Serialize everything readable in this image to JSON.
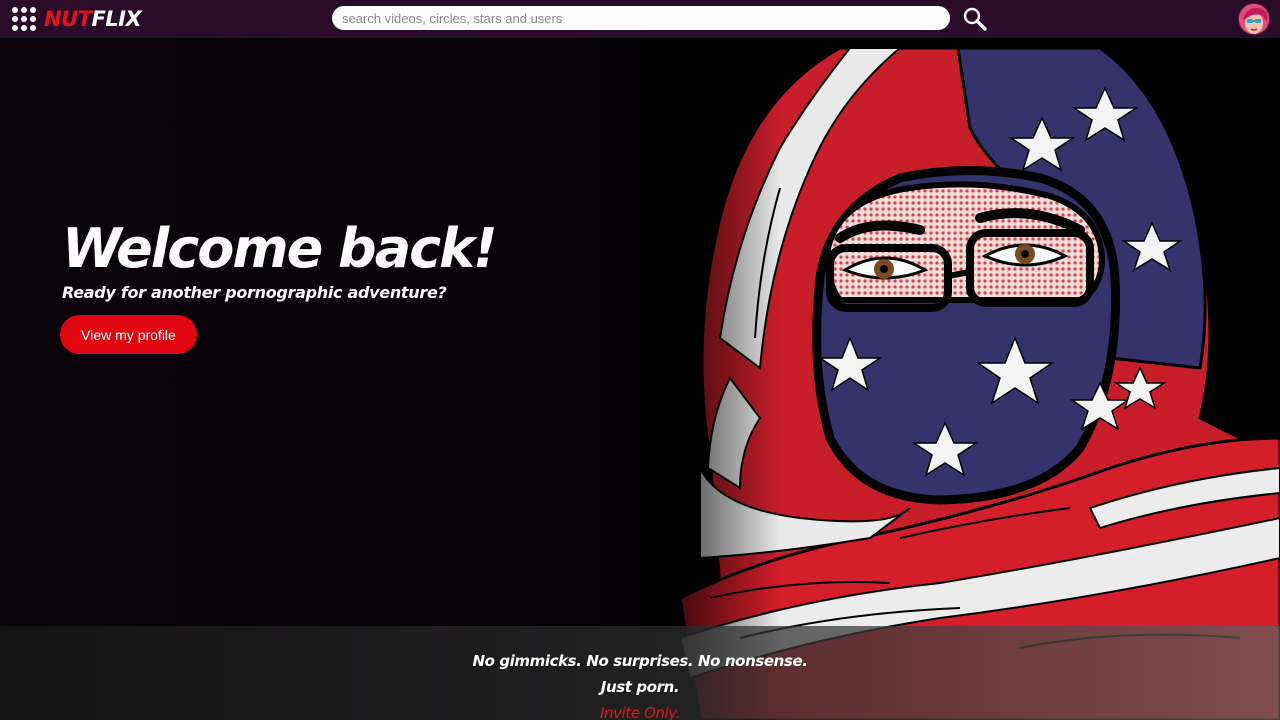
{
  "header": {
    "logo_part1": "NUT",
    "logo_part2": "FLIX",
    "search_placeholder": "search videos, circles, stars and users",
    "apps_icon": "grid-dots-icon",
    "search_icon": "magnifier-icon",
    "avatar_icon": "user-avatar"
  },
  "hero": {
    "title": "Welcome back!",
    "subtitle": "Ready for another pornographic adventure?",
    "button_label": "View my profile"
  },
  "footer_band": {
    "line1": "No gimmicks. No surprises. No nonsense.",
    "line2": "Just porn.",
    "line3": "Invite Only."
  },
  "colors": {
    "brand_red": "#e0141e",
    "topbar_bg": "#2a0c2a",
    "button_bg": "#e0060f",
    "flag_blue": "#35336b",
    "flag_red": "#d41e2a"
  }
}
